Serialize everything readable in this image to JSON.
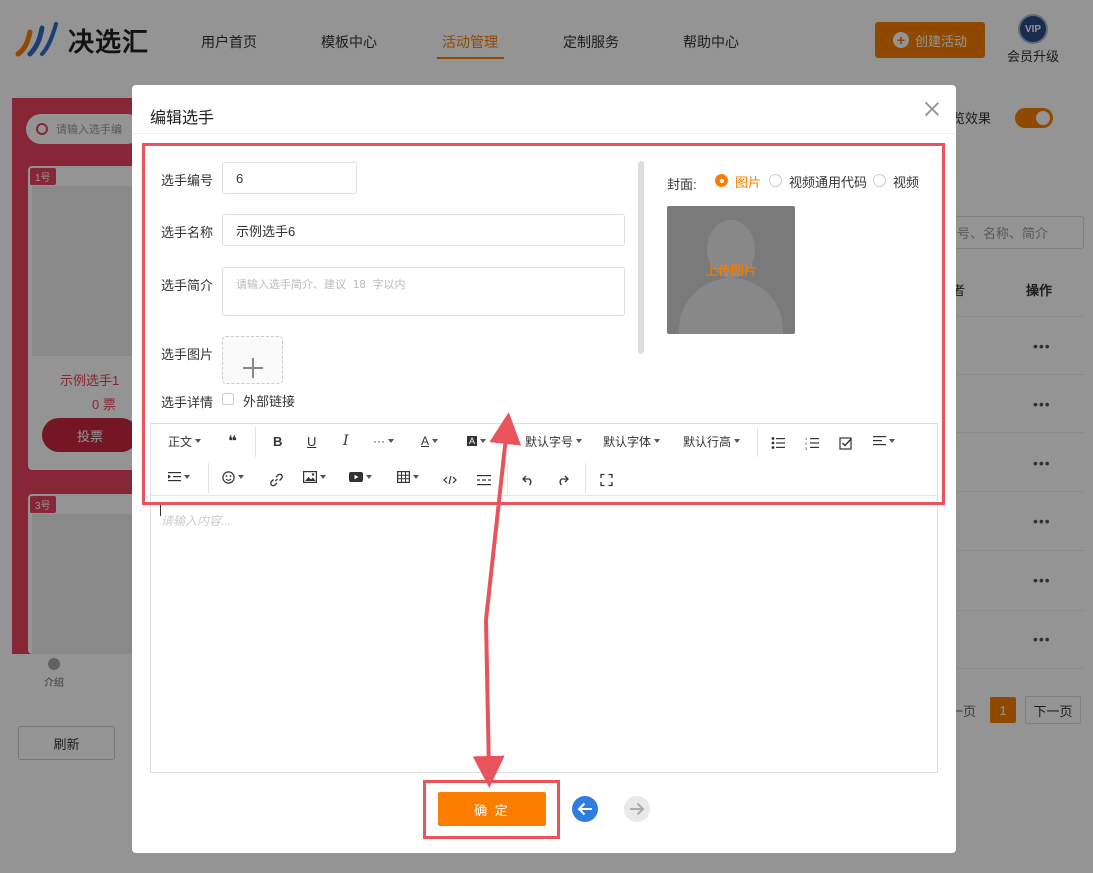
{
  "brand": {
    "name": "决选汇"
  },
  "nav": {
    "items": [
      "用户首页",
      "模板中心",
      "活动管理",
      "定制服务",
      "帮助中心"
    ],
    "active": "活动管理",
    "create_label": "创建活动",
    "vip_badge": "VIP",
    "vip_label": "会员升级"
  },
  "background": {
    "search_placeholder": "请输入选手编",
    "cards": [
      {
        "num": "1号",
        "name": "示例选手1",
        "votes": "0 票",
        "vote_label": "投票"
      },
      {
        "num": "3号"
      }
    ],
    "mini_nav_label": "介绍",
    "refresh_label": "刷新",
    "preview_label": "览效果",
    "right_search_placeholder": "号、名称、简介",
    "col_header": "操作",
    "col_header_partial": "者",
    "row_action": "•••",
    "pager": {
      "prev": "一页",
      "current": "1",
      "next": "下一页"
    }
  },
  "modal": {
    "title": "编辑选手",
    "fields": {
      "number_label": "选手编号",
      "number_value": "6",
      "name_label": "选手名称",
      "name_value": "示例选手6",
      "intro_label": "选手简介",
      "intro_placeholder": "请输入选手简介、建议 18 字以内",
      "image_label": "选手图片",
      "detail_label": "选手详情",
      "external_link_label": "外部链接"
    },
    "cover": {
      "label": "封面:",
      "options": [
        "图片",
        "视频通用代码",
        "视频"
      ],
      "selected": "图片",
      "upload_text": "上传图片"
    },
    "editor": {
      "toolbar_row1": [
        "正文",
        "❝",
        "B",
        "U",
        "I",
        "···",
        "A",
        "A",
        "默认字号",
        "默认字体",
        "默认行高"
      ],
      "placeholder": "请输入内容..."
    },
    "confirm_label": "确 定"
  },
  "colors": {
    "accent": "#f77f00",
    "annotation": "#e9535c",
    "prev_arrow": "#2f7de1",
    "left_panel": "#e8425d"
  }
}
